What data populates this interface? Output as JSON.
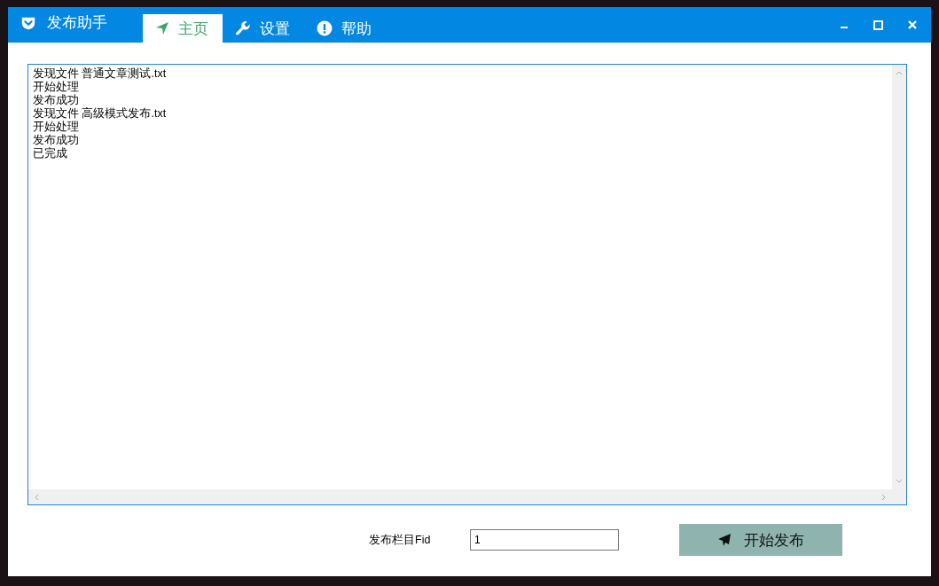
{
  "window": {
    "title": "发布助手"
  },
  "tabs": [
    {
      "label": "主页",
      "selected": true
    },
    {
      "label": "设置",
      "selected": false
    },
    {
      "label": "帮助",
      "selected": false
    }
  ],
  "log": {
    "lines": [
      "发现文件 普通文章测试.txt",
      "开始处理",
      "发布成功",
      "发现文件 高级模式发布.txt",
      "开始处理",
      "发布成功",
      "已完成"
    ]
  },
  "form": {
    "label": "发布栏目Fid",
    "value": "1"
  },
  "publish_button": {
    "label": "开始发布"
  }
}
